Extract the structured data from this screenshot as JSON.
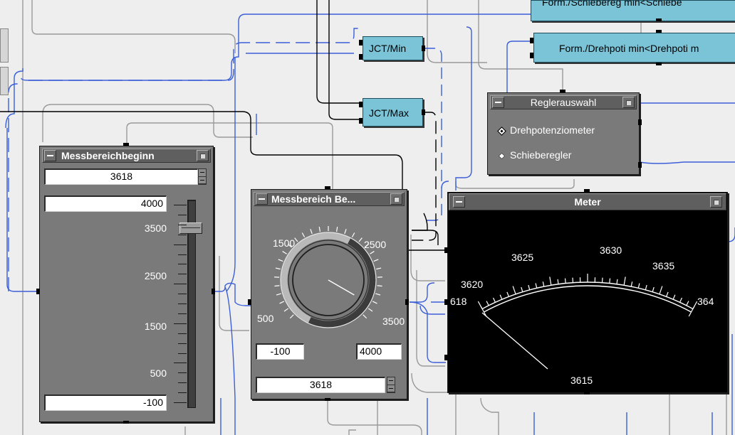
{
  "junctions": {
    "min_label": "JCT/Min",
    "max_label": "JCT/Max"
  },
  "formulas": {
    "top_label": "Form./Schiebereg min<Schiebe",
    "mid_label": "Form./Drehpoti min<Drehpoti m"
  },
  "reglerauswahl": {
    "title": "Reglerauswahl",
    "options": [
      "Drehpotenziometer",
      "Schieberegler"
    ],
    "selected": "Drehpotenziometer"
  },
  "messbereichbeginn": {
    "title": "Messbereichbeginn",
    "value": "3618",
    "max_value": "4000",
    "min_value": "-100",
    "scale": [
      "3500",
      "2500",
      "1500",
      "500"
    ],
    "slider_level": 0.88
  },
  "messbereich_be": {
    "title": "Messbereich Be...",
    "dial_labels": [
      "1500",
      "2500",
      "500",
      "3500"
    ],
    "min_value": "-100",
    "max_value": "4000",
    "value": "3618"
  },
  "meter": {
    "title": "Meter",
    "scale_labels": [
      "3620",
      "3625",
      "3630",
      "3635"
    ],
    "left_label": "618",
    "right_label": "364",
    "value": "3615"
  },
  "colors": {
    "wire_data": "#3b5fd8",
    "wire_seq": "#9a9a9a",
    "wire_ctrl": "#000000",
    "panel_bg": "#7a7a7a",
    "titlebar": "#5f5f5f",
    "junction": "#7bc3d6",
    "meter_bg": "#000000"
  },
  "icons": [
    "minimize-icon",
    "maximize-icon",
    "spinner-icon",
    "radio-diamond-icon"
  ]
}
